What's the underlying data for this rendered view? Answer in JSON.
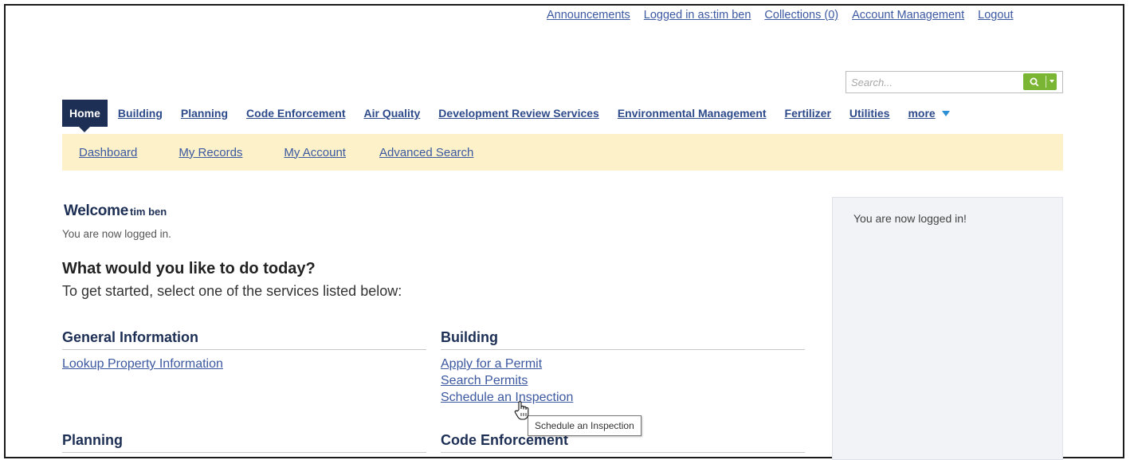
{
  "top_links": [
    "Announcements",
    "Logged in as:tim ben",
    "Collections (0)",
    "Account Management",
    "Logout"
  ],
  "search": {
    "placeholder": "Search..."
  },
  "main_nav": {
    "home": "Home",
    "items": [
      "Building",
      "Planning",
      "Code Enforcement",
      "Air Quality",
      "Development Review Services",
      "Environmental Management",
      "Fertilizer",
      "Utilities"
    ],
    "more": "more"
  },
  "sub_nav": [
    "Dashboard",
    "My Records",
    "My Account",
    "Advanced Search"
  ],
  "welcome": {
    "title": "Welcome",
    "user": "tim ben",
    "subtitle": "You are now logged in."
  },
  "prompt": {
    "title": "What would you like to do today?",
    "subtitle": "To get started, select one of the services listed below:"
  },
  "sections": {
    "general": {
      "title": "General Information",
      "links": [
        "Lookup Property Information"
      ]
    },
    "building": {
      "title": "Building",
      "links": [
        "Apply for a Permit",
        "Search Permits",
        "Schedule an Inspection"
      ]
    },
    "planning": {
      "title": "Planning"
    },
    "code_enforcement": {
      "title": "Code Enforcement"
    }
  },
  "right_panel": {
    "message": "You are now logged in!"
  },
  "tooltip": "Schedule an Inspection",
  "colors": {
    "nav_dark": "#1d2f55",
    "link": "#3b58a0",
    "subnav_bg": "#fcf1c9",
    "search_btn": "#7ab533"
  }
}
